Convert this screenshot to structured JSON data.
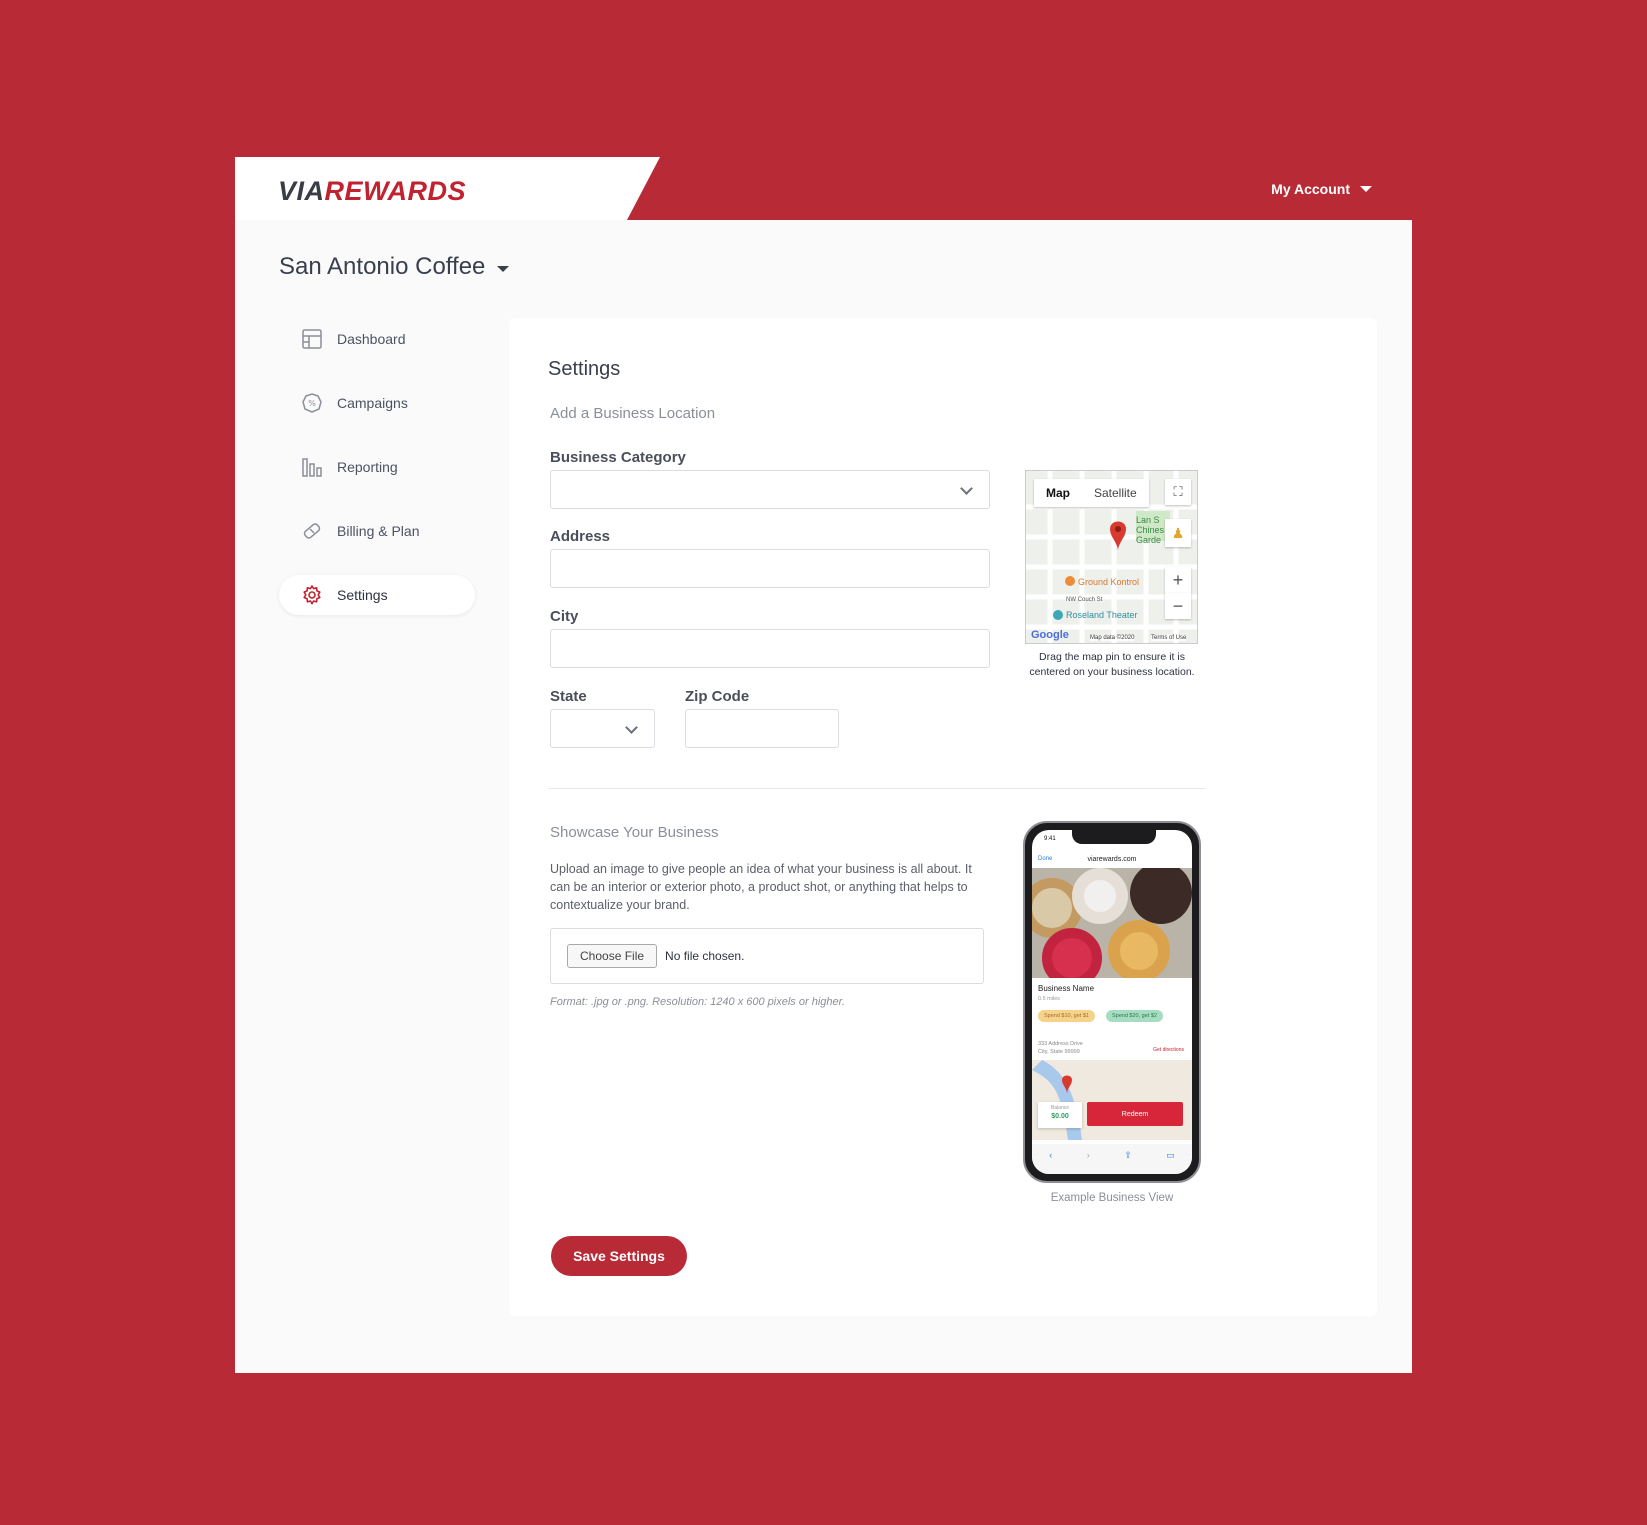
{
  "brand": {
    "part1": "VIA",
    "part2": "REWARDS",
    "accent": "#b82a35"
  },
  "header": {
    "account_label": "My Account"
  },
  "business": {
    "name": "San Antonio Coffee"
  },
  "nav": [
    {
      "label": "Dashboard",
      "icon": "dashboard-icon",
      "active": false
    },
    {
      "label": "Campaigns",
      "icon": "campaigns-icon",
      "active": false
    },
    {
      "label": "Reporting",
      "icon": "reporting-icon",
      "active": false
    },
    {
      "label": "Billing & Plan",
      "icon": "billing-icon",
      "active": false
    },
    {
      "label": "Settings",
      "icon": "settings-icon",
      "active": true
    }
  ],
  "settings": {
    "title": "Settings",
    "location_section": "Add a Business Location",
    "category_label": "Business Category",
    "category_value": "",
    "address_label": "Address",
    "address_value": "",
    "city_label": "City",
    "city_value": "",
    "state_label": "State",
    "state_value": "",
    "zip_label": "Zip Code",
    "zip_value": "",
    "showcase_section": "Showcase Your Business",
    "showcase_desc": "Upload an image to give people an idea of what your business is all about. It can be an interior or exterior photo, a product shot, or anything that helps to contextualize your brand.",
    "choose_file": "Choose File",
    "no_file": "No file chosen.",
    "format_hint": "Format: .jpg or .png. Resolution: 1240 x 600 pixels or higher.",
    "save_label": "Save Settings"
  },
  "map": {
    "tab_map": "Map",
    "tab_satellite": "Satellite",
    "place1": "Ground Kontrol",
    "place2": "Roseland Theater",
    "street": "NW Couch St",
    "park": "Lan S Chines Garde",
    "google": "Google",
    "data": "Map data ©2020",
    "terms": "Terms of Use",
    "caption": "Drag the map pin to ensure it is centered on your business location."
  },
  "phone": {
    "time": "9:41",
    "done": "Done",
    "url": "viarewards.com",
    "business_name": "Business Name",
    "distance": "0.5 miles",
    "offer1": "Spend $10, get $1",
    "offer2": "Spend $20, get $2",
    "address1": "333 Address Drive",
    "address2": "City, State 99999",
    "directions": "Get directions",
    "balance_label": "Balance",
    "balance_value": "$0.00",
    "redeem": "Redeem",
    "caption": "Example Business View"
  }
}
